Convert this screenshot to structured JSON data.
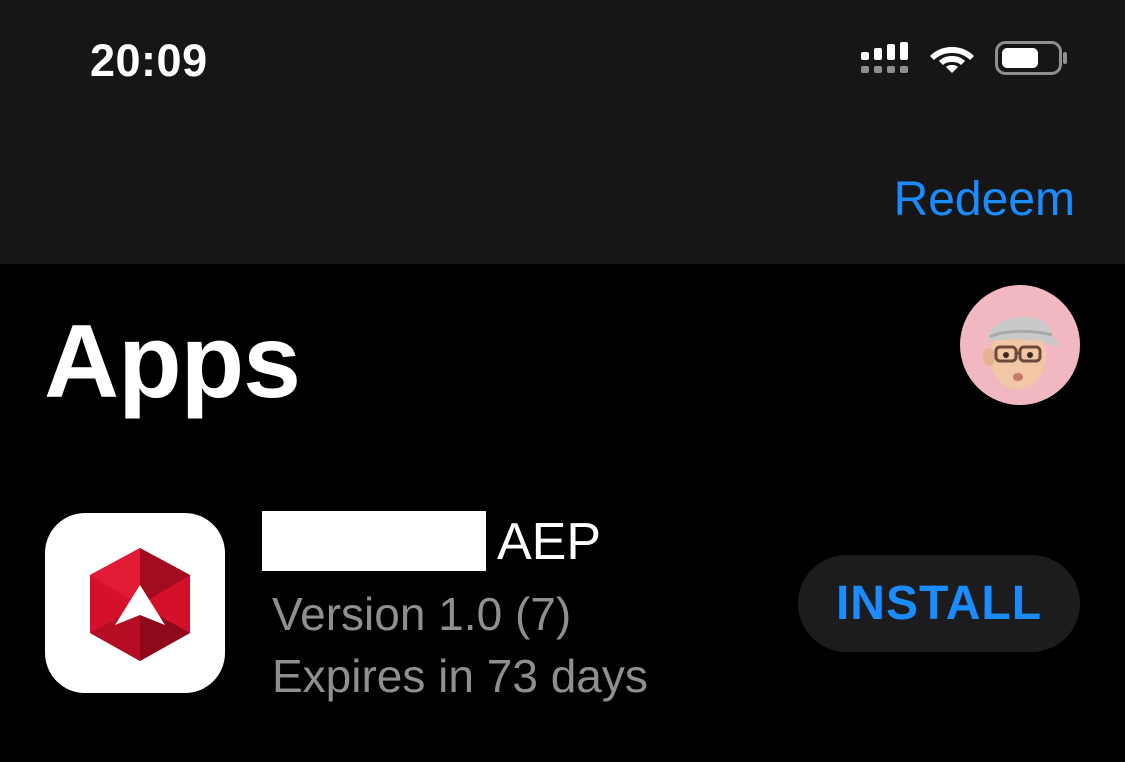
{
  "status_bar": {
    "time": "20:09",
    "signal_icon": "cellular-signal-icon",
    "wifi_icon": "wifi-icon",
    "battery_icon": "battery-icon"
  },
  "nav": {
    "redeem_label": "Redeem"
  },
  "page": {
    "title": "Apps",
    "avatar_icon": "memoji-avatar-icon"
  },
  "apps": [
    {
      "name_suffix": "AEP",
      "version": "Version 1.0 (7)",
      "expires": "Expires in 73 days",
      "action_label": "INSTALL",
      "icon": "red-hexagon-app-icon"
    }
  ],
  "colors": {
    "accent": "#1a8cff",
    "background": "#000000",
    "top_bar": "#161616",
    "secondary_text": "#8e8e93",
    "button_bg": "#1c1c1e",
    "app_icon_red": "#d4102b"
  }
}
